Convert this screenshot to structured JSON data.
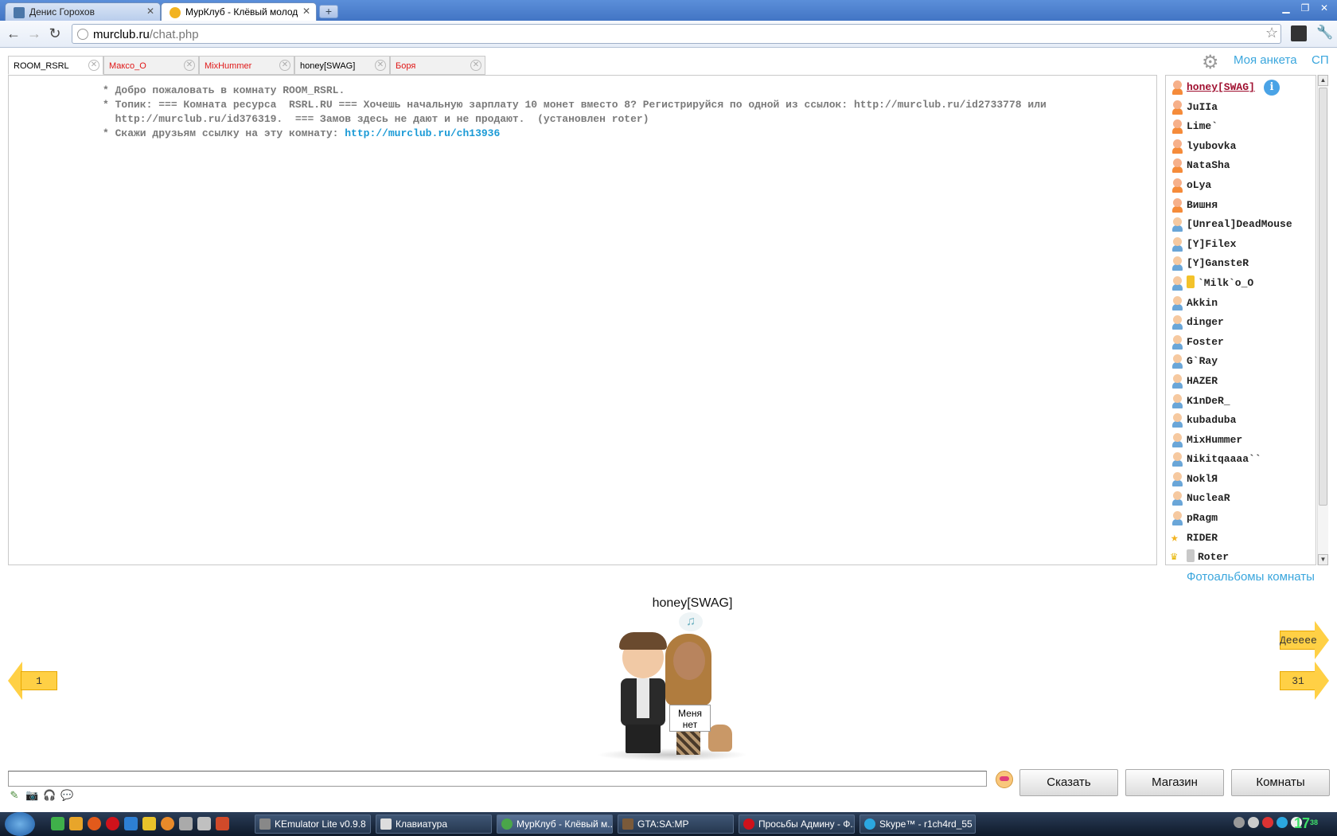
{
  "browser": {
    "tabs": [
      {
        "title": "Денис Горохов",
        "favicon_color": "#4a76a8"
      },
      {
        "title": "МурКлуб - Клёвый молод",
        "favicon_color": "#f2b320"
      }
    ],
    "address": {
      "domain": "murclub.ru",
      "path": "/chat.php"
    }
  },
  "chat": {
    "room_tabs": [
      {
        "label": "ROOM_RSRL",
        "active": true,
        "unread": false
      },
      {
        "label": "Максо_О",
        "active": false,
        "unread": true
      },
      {
        "label": "MixHummer",
        "active": false,
        "unread": true
      },
      {
        "label": "honey[SWAG]",
        "active": false,
        "unread": false
      },
      {
        "label": "Боря",
        "active": false,
        "unread": true
      }
    ],
    "header_links": {
      "profile": "Моя анкета",
      "sp": "СП"
    },
    "messages": [
      {
        "text": "* Добро пожаловать в комнату ROOM_RSRL.",
        "link": ""
      },
      {
        "text": "* Топик: === Комната ресурса  RSRL.RU === Хочешь начальную зарплату 10 монет вместо 8? Регистрируйся по одной из ссылок: http://murclub.ru/id2733778 или",
        "link": ""
      },
      {
        "text": "  http://murclub.ru/id376319.  === Замов здесь не дают и не продают.  (установлен roter)",
        "link": ""
      },
      {
        "text": "* Скажи друзьям ссылку на эту комнату: ",
        "link": "http://murclub.ru/ch13936"
      }
    ],
    "users": [
      {
        "name": "honey[SWAG]",
        "gender": "f",
        "selected": true,
        "badge": ""
      },
      {
        "name": "JuIIa",
        "gender": "f",
        "selected": false,
        "badge": ""
      },
      {
        "name": "Lime`",
        "gender": "f",
        "selected": false,
        "badge": ""
      },
      {
        "name": "lyubovka",
        "gender": "f",
        "selected": false,
        "badge": ""
      },
      {
        "name": "NataSha",
        "gender": "f",
        "selected": false,
        "badge": ""
      },
      {
        "name": "oLya",
        "gender": "f",
        "selected": false,
        "badge": ""
      },
      {
        "name": "Вишня",
        "gender": "f",
        "selected": false,
        "badge": ""
      },
      {
        "name": "[Unreal]DeadMouse",
        "gender": "m",
        "selected": false,
        "badge": ""
      },
      {
        "name": "[Y]Filex",
        "gender": "m",
        "selected": false,
        "badge": ""
      },
      {
        "name": "[Y]GansteR",
        "gender": "m",
        "selected": false,
        "badge": ""
      },
      {
        "name": "`Milk`o_O",
        "gender": "m",
        "selected": false,
        "badge": "gold"
      },
      {
        "name": "Akkin",
        "gender": "m",
        "selected": false,
        "badge": ""
      },
      {
        "name": "dinger",
        "gender": "m",
        "selected": false,
        "badge": ""
      },
      {
        "name": "Foster",
        "gender": "m",
        "selected": false,
        "badge": ""
      },
      {
        "name": "G`Ray",
        "gender": "m",
        "selected": false,
        "badge": ""
      },
      {
        "name": "HAZER",
        "gender": "m",
        "selected": false,
        "badge": ""
      },
      {
        "name": "K1nDeR_",
        "gender": "m",
        "selected": false,
        "badge": ""
      },
      {
        "name": "kubaduba",
        "gender": "m",
        "selected": false,
        "badge": ""
      },
      {
        "name": "MixHummer",
        "gender": "m",
        "selected": false,
        "badge": ""
      },
      {
        "name": "Nikitqaaaa``",
        "gender": "m",
        "selected": false,
        "badge": ""
      },
      {
        "name": "NoklЯ",
        "gender": "m",
        "selected": false,
        "badge": ""
      },
      {
        "name": "NucleaR",
        "gender": "m",
        "selected": false,
        "badge": ""
      },
      {
        "name": "pRagm",
        "gender": "m",
        "selected": false,
        "badge": ""
      },
      {
        "name": "RIDER",
        "gender": "star",
        "selected": false,
        "badge": ""
      },
      {
        "name": "Roter",
        "gender": "crown",
        "selected": false,
        "badge": "silver"
      }
    ],
    "albums_link": "Фотоальбомы комнаты",
    "profile_view": {
      "name": "honey[SWAG]",
      "note_icon": "♫",
      "sign": [
        "Меня",
        "нет"
      ]
    },
    "nav_arrows": {
      "left_label": "1",
      "right_top_label": "Деееее",
      "right_bottom_label": "31"
    },
    "input": {
      "value": "",
      "placeholder": ""
    },
    "buttons": {
      "say": "Сказать",
      "shop": "Магазин",
      "rooms": "Комнаты"
    },
    "colors": {
      "link": "#3aa6dd",
      "unread_tab": "#e01818",
      "arrow": "#ffd045"
    }
  },
  "taskbar": {
    "windows": [
      {
        "title": "KEmulator Lite v0.9.8",
        "active": false
      },
      {
        "title": "Клавиатура",
        "active": false
      },
      {
        "title": "МурКлуб - Клёвый м...",
        "active": true
      },
      {
        "title": "GTA:SA:MP",
        "active": false
      },
      {
        "title": "Просьбы Админу - Ф...",
        "active": false
      },
      {
        "title": "Skype™ - r1ch4rd_55",
        "active": false
      }
    ],
    "clock": {
      "time": "17",
      "small": "38"
    }
  }
}
